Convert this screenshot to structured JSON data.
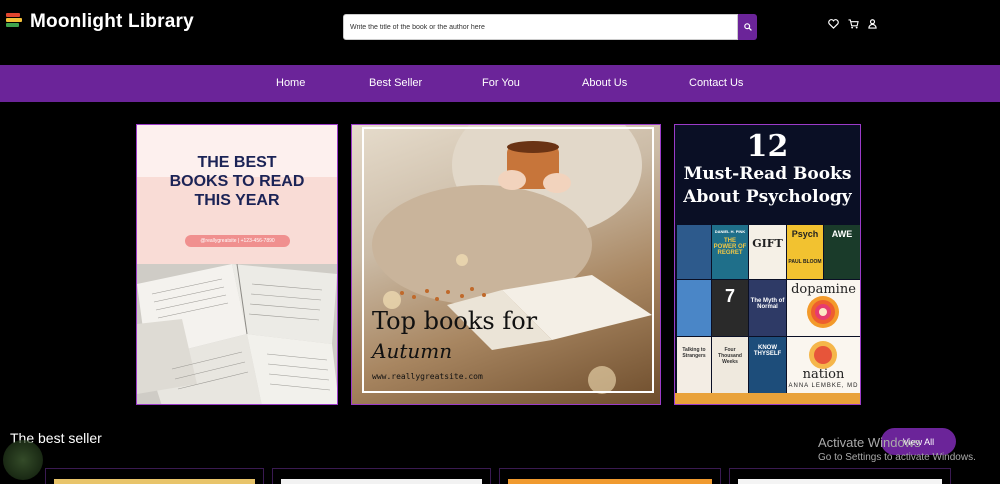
{
  "header": {
    "app_title": "Moonlight Library",
    "logo_icon": "books-stack-icon",
    "search": {
      "placeholder": "Write the title of the book or the author here",
      "value": "",
      "icon": "search-icon"
    },
    "icons": [
      "heart-icon",
      "cart-icon",
      "user-icon"
    ]
  },
  "nav": {
    "items": [
      {
        "label": "Home"
      },
      {
        "label": "Best Seller"
      },
      {
        "label": "For You"
      },
      {
        "label": "About Us"
      },
      {
        "label": "Contact Us"
      }
    ]
  },
  "banners": {
    "banner1": {
      "title_line1": "THE BEST",
      "title_line2": "BOOKS TO READ",
      "title_line3": "THIS YEAR",
      "contact": "@reallygreatsite | +123-456-7890"
    },
    "banner2": {
      "title": "Top books for",
      "subtitle": "Autumn",
      "url": "www.reallygreatsite.com"
    },
    "banner3": {
      "number": "12",
      "title_line1": "Must-Read Books",
      "title_line2": "About Psychology",
      "covers": {
        "regret_author": "DANIEL H. PINK",
        "regret_title": "THE POWER OF REGRET",
        "gift": "GIFT",
        "psych": "Psych",
        "psych_author": "PAUL BLOOM",
        "awe": "AWE",
        "myth": "The Myth of Normal",
        "know": "KNOW THYSELF",
        "dopamine_title": "dopamine",
        "dopamine_sub": "nation",
        "dopamine_author": "ANNA LEMBKE, MD",
        "strangers": "Talking to Strangers",
        "weeks": "Four Thousand Weeks"
      }
    }
  },
  "best_seller": {
    "section_title": "The best seller",
    "view_all_label": "View All"
  },
  "watermark": {
    "title": "Activate Windows",
    "subtitle": "Go to Settings to activate Windows."
  },
  "colors": {
    "brand_purple": "#6b2499",
    "background": "#000000",
    "banner_border": "#9b3bc9"
  }
}
